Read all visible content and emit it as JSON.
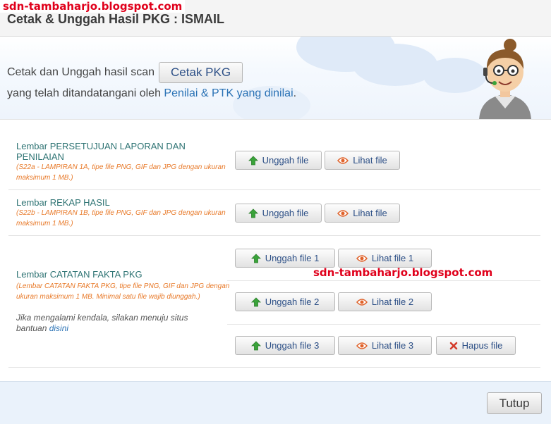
{
  "watermark": "sdn-tambaharjo.blogspot.com",
  "header": {
    "title": "Cetak & Unggah Hasil PKG : ISMAIL"
  },
  "banner": {
    "line1": "Cetak dan Unggah hasil scan",
    "cetak_label": "Cetak PKG",
    "line2_prefix": "yang telah ditandatangani oleh ",
    "line2_highlight": "Penilai & PTK yang dinilai",
    "line2_suffix": "."
  },
  "rows": [
    {
      "title": "Lembar PERSETUJUAN LAPORAN DAN PENILAIAN",
      "note": "(S22a - LAMPIRAN 1A, tipe file PNG, GIF dan JPG dengan ukuran maksimum 1 MB.)",
      "upload": "Unggah file",
      "view": "Lihat file"
    },
    {
      "title": "Lembar REKAP HASIL",
      "note": "(S22b - LAMPIRAN 1B, tipe file PNG, GIF dan JPG dengan ukuran maksimum 1 MB.)",
      "upload": "Unggah file",
      "view": "Lihat file"
    },
    {
      "title": "Lembar CATATAN FAKTA PKG",
      "note": "(Lembar CATATAN FAKTA PKG, tipe file PNG, GIF dan JPG dengan ukuran maksimum 1 MB. Minimal satu file wajib diunggah.)",
      "help_prefix": "Jika mengalami kendala, silakan menuju situs bantuan ",
      "help_link": "disini",
      "files": [
        {
          "upload": "Unggah file 1",
          "view": "Lihat file 1"
        },
        {
          "upload": "Unggah file 2",
          "view": "Lihat file 2"
        },
        {
          "upload": "Unggah file 3",
          "view": "Lihat file 3",
          "delete": "Hapus file"
        }
      ]
    }
  ],
  "footer": {
    "close_label": "Tutup"
  },
  "colors": {
    "title_teal": "#2f7474",
    "note_orange": "#e87a2a",
    "link_blue": "#2a72b5",
    "upload_green": "#3aa33a",
    "view_orange": "#e0622a",
    "delete_red": "#d33a2a"
  }
}
